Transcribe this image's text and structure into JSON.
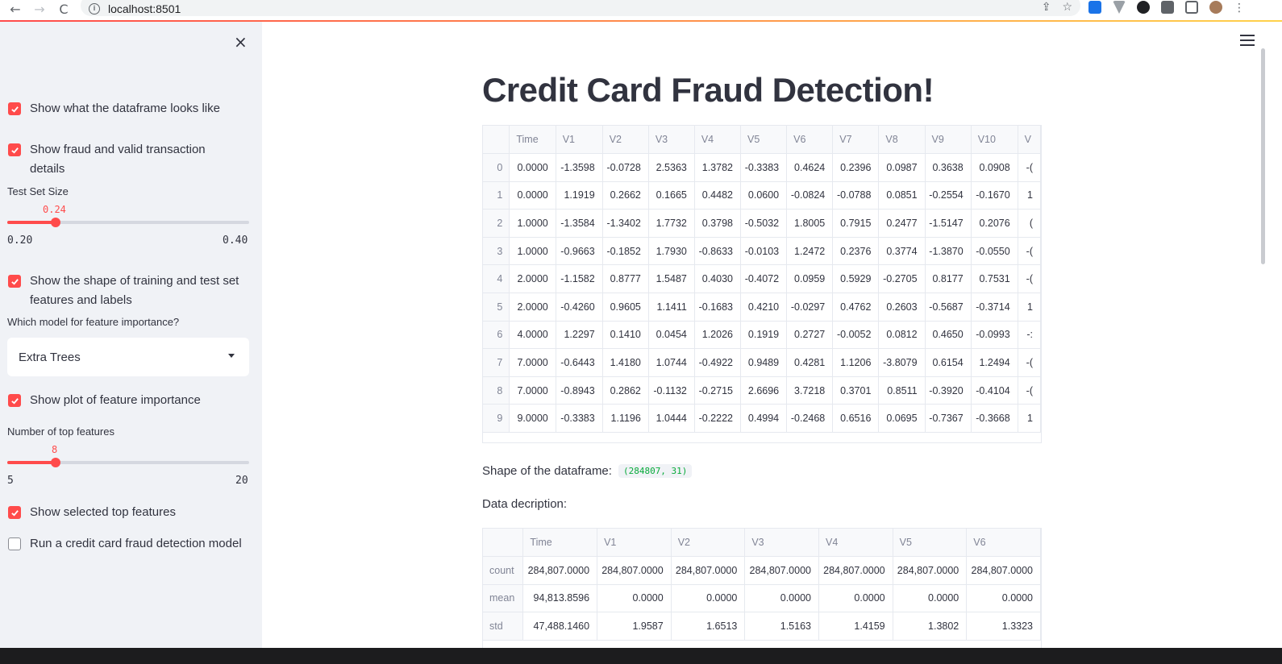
{
  "browser": {
    "url": "localhost:8501",
    "back_glyph": "←",
    "forward_glyph": "→",
    "reload_glyph": "C"
  },
  "sidebar": {
    "close_glyph": "×",
    "checkboxes": {
      "show_dataframe": {
        "label": "Show what the dataframe looks like",
        "checked": true
      },
      "show_fraud_valid": {
        "label": "Show fraud and valid transaction details",
        "checked": true
      },
      "show_shape": {
        "label": "Show the shape of training and test set features and labels",
        "checked": true
      },
      "show_plot": {
        "label": "Show plot of feature importance",
        "checked": true
      },
      "show_top_features": {
        "label": "Show selected top features",
        "checked": true
      },
      "run_model": {
        "label": "Run a credit card fraud detection model",
        "checked": false
      }
    },
    "test_set_slider": {
      "label": "Test Set Size",
      "value": "0.24",
      "min": "0.20",
      "max": "0.40",
      "fraction": 0.2
    },
    "model_select": {
      "label": "Which model for feature importance?",
      "selected": "Extra Trees"
    },
    "top_features_slider": {
      "label": "Number of top features",
      "value": "8",
      "min": "5",
      "max": "20",
      "fraction": 0.2
    }
  },
  "main": {
    "title": "Credit Card Fraud Detection!",
    "shape_label": "Shape of the dataframe:",
    "shape_value": "(284807, 31)",
    "description_label": "Data decription:"
  },
  "dataframe": {
    "columns": [
      "",
      "Time",
      "V1",
      "V2",
      "V3",
      "V4",
      "V5",
      "V6",
      "V7",
      "V8",
      "V9",
      "V10",
      "V"
    ],
    "rows": [
      [
        "0",
        "0.0000",
        "-1.3598",
        "-0.0728",
        "2.5363",
        "1.3782",
        "-0.3383",
        "0.4624",
        "0.2396",
        "0.0987",
        "0.3638",
        "0.0908",
        "-("
      ],
      [
        "1",
        "0.0000",
        "1.1919",
        "0.2662",
        "0.1665",
        "0.4482",
        "0.0600",
        "-0.0824",
        "-0.0788",
        "0.0851",
        "-0.2554",
        "-0.1670",
        "1"
      ],
      [
        "2",
        "1.0000",
        "-1.3584",
        "-1.3402",
        "1.7732",
        "0.3798",
        "-0.5032",
        "1.8005",
        "0.7915",
        "0.2477",
        "-1.5147",
        "0.2076",
        "("
      ],
      [
        "3",
        "1.0000",
        "-0.9663",
        "-0.1852",
        "1.7930",
        "-0.8633",
        "-0.0103",
        "1.2472",
        "0.2376",
        "0.3774",
        "-1.3870",
        "-0.0550",
        "-("
      ],
      [
        "4",
        "2.0000",
        "-1.1582",
        "0.8777",
        "1.5487",
        "0.4030",
        "-0.4072",
        "0.0959",
        "0.5929",
        "-0.2705",
        "0.8177",
        "0.7531",
        "-("
      ],
      [
        "5",
        "2.0000",
        "-0.4260",
        "0.9605",
        "1.1411",
        "-0.1683",
        "0.4210",
        "-0.0297",
        "0.4762",
        "0.2603",
        "-0.5687",
        "-0.3714",
        "1"
      ],
      [
        "6",
        "4.0000",
        "1.2297",
        "0.1410",
        "0.0454",
        "1.2026",
        "0.1919",
        "0.2727",
        "-0.0052",
        "0.0812",
        "0.4650",
        "-0.0993",
        "-:"
      ],
      [
        "7",
        "7.0000",
        "-0.6443",
        "1.4180",
        "1.0744",
        "-0.4922",
        "0.9489",
        "0.4281",
        "1.1206",
        "-3.8079",
        "0.6154",
        "1.2494",
        "-("
      ],
      [
        "8",
        "7.0000",
        "-0.8943",
        "0.2862",
        "-0.1132",
        "-0.2715",
        "2.6696",
        "3.7218",
        "0.3701",
        "0.8511",
        "-0.3920",
        "-0.4104",
        "-("
      ],
      [
        "9",
        "9.0000",
        "-0.3383",
        "1.1196",
        "1.0444",
        "-0.2222",
        "0.4994",
        "-0.2468",
        "0.6516",
        "0.0695",
        "-0.7367",
        "-0.3668",
        "1"
      ]
    ]
  },
  "describe": {
    "columns": [
      "",
      "Time",
      "V1",
      "V2",
      "V3",
      "V4",
      "V5",
      "V6"
    ],
    "rows": [
      [
        "count",
        "284,807.0000",
        "284,807.0000",
        "284,807.0000",
        "284,807.0000",
        "284,807.0000",
        "284,807.0000",
        "284,807.0000"
      ],
      [
        "mean",
        "94,813.8596",
        "0.0000",
        "0.0000",
        "0.0000",
        "0.0000",
        "0.0000",
        "0.0000"
      ],
      [
        "std",
        "47,488.1460",
        "1.9587",
        "1.6513",
        "1.5163",
        "1.4159",
        "1.3802",
        "1.3323"
      ]
    ]
  },
  "colors": {
    "accent": "#ff4b4b",
    "sidebar_bg": "#f0f2f6",
    "text": "#31333f",
    "code_green": "#09ab3b"
  }
}
